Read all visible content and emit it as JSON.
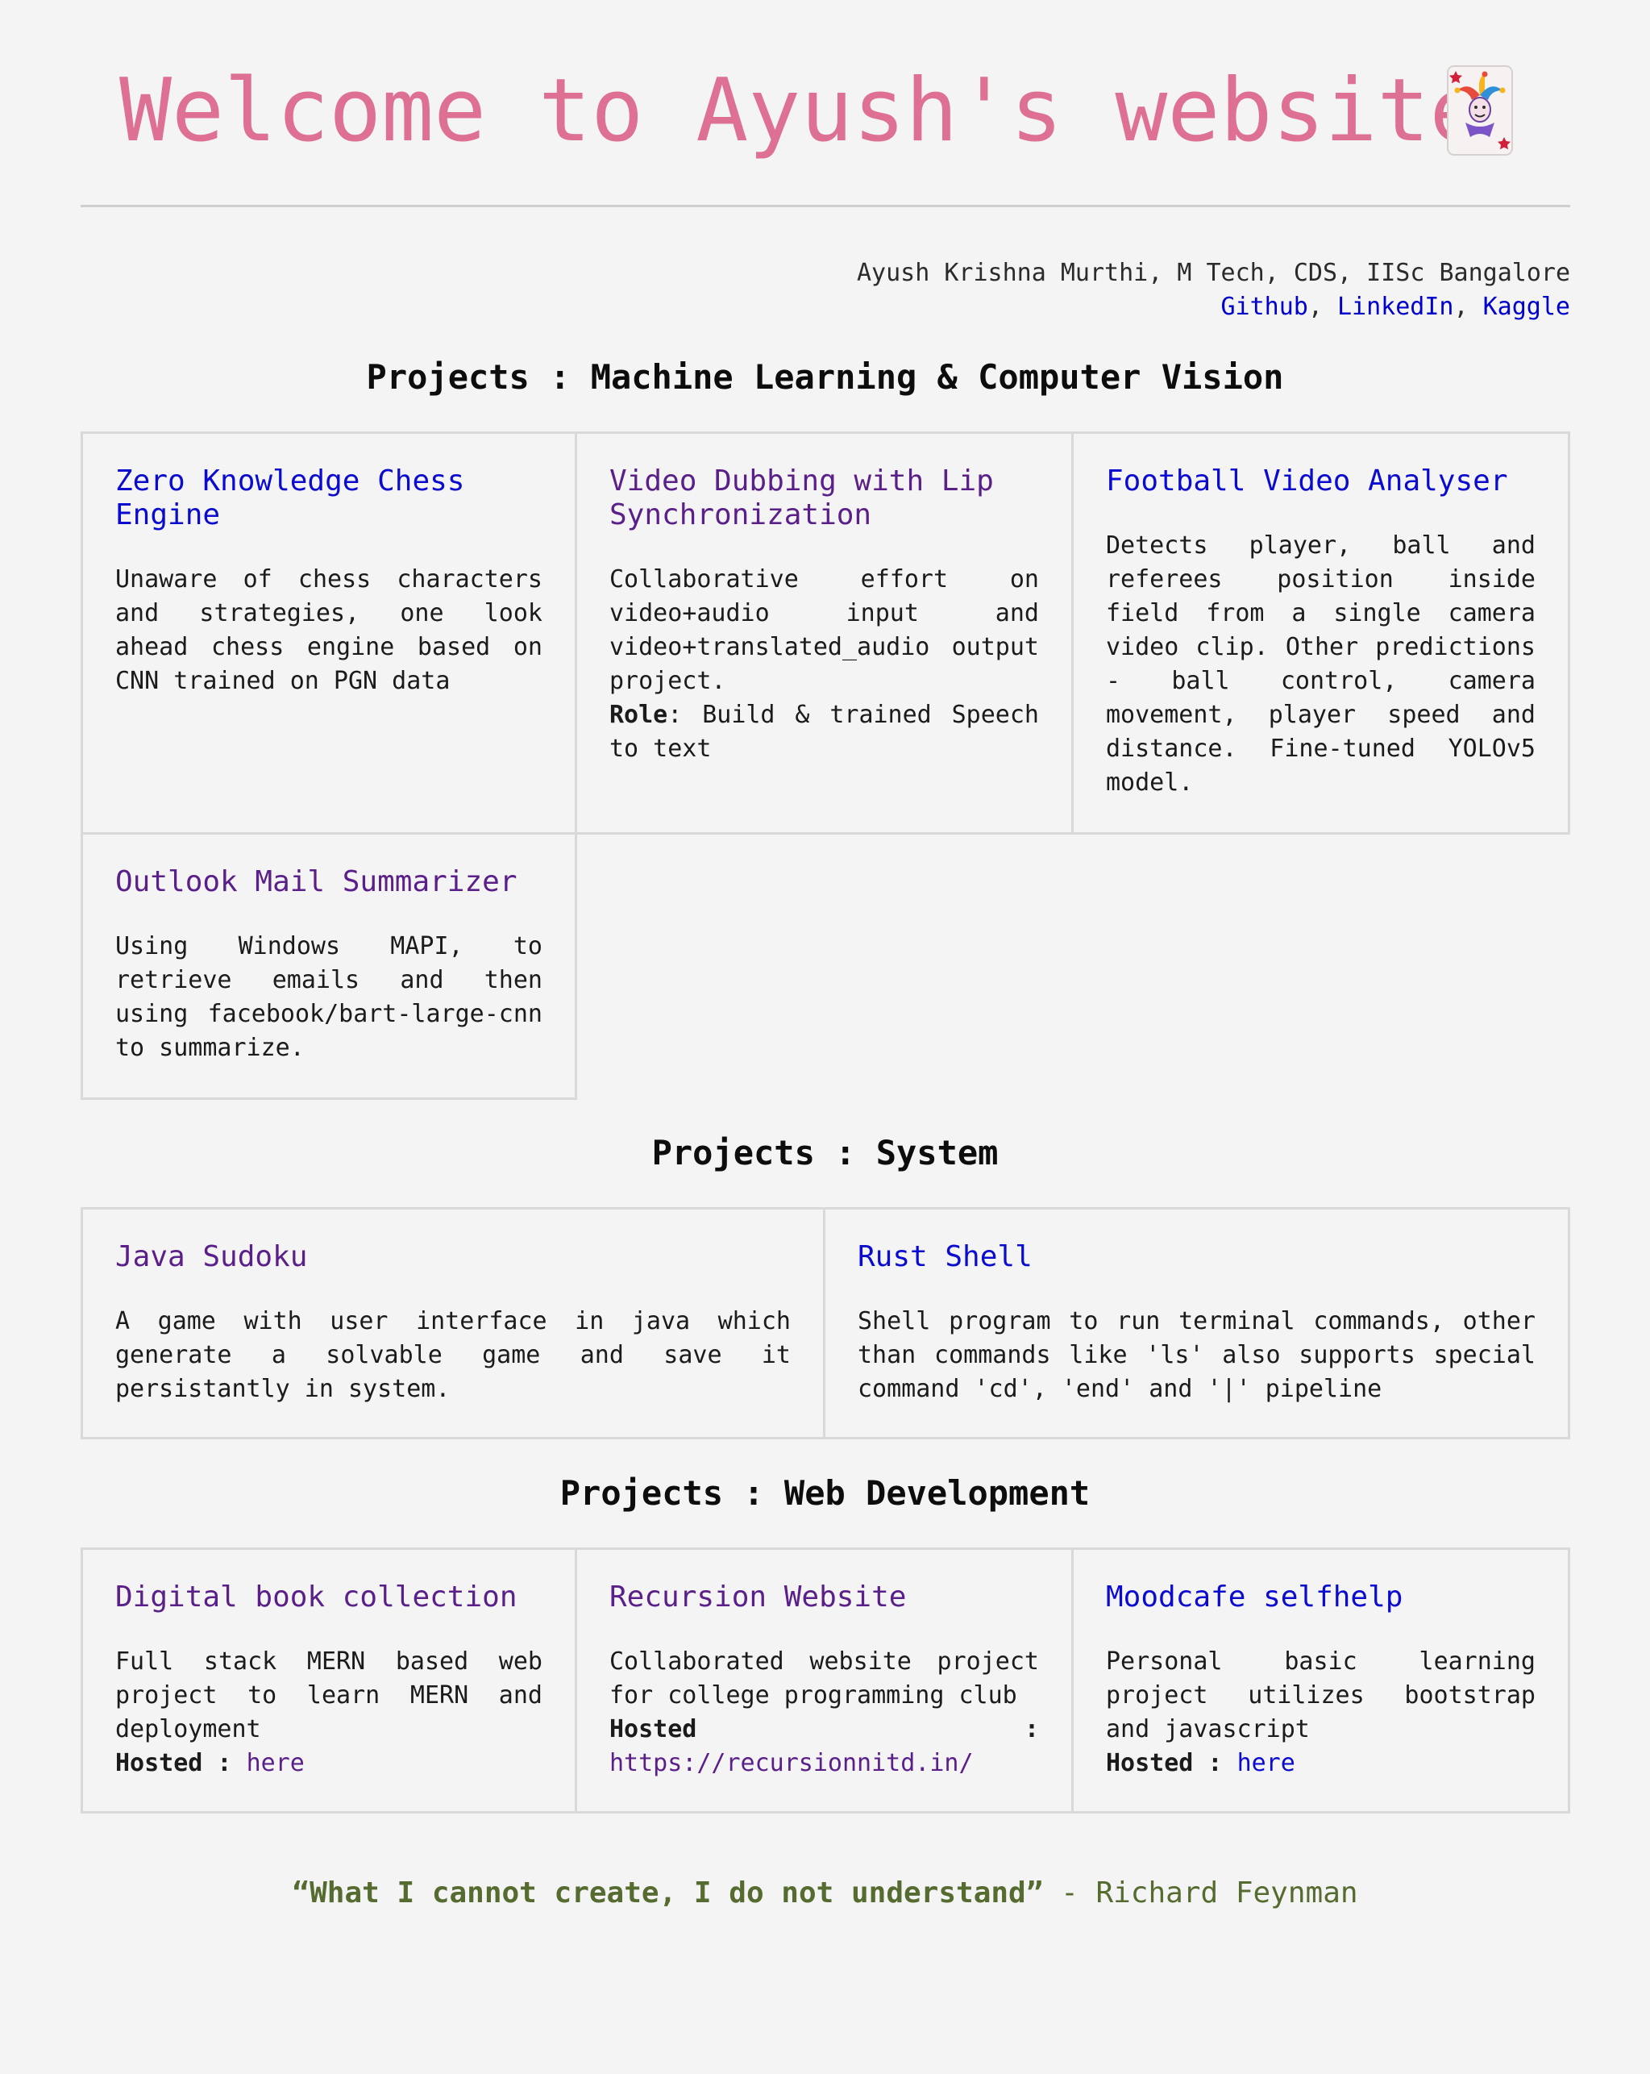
{
  "header": {
    "title": "Welcome to Ayush's website",
    "icon": "joker-card-icon"
  },
  "author": {
    "name_line": "Ayush Krishna Murthi, M Tech, CDS, IISc Bangalore",
    "links": [
      "Github",
      "LinkedIn",
      "Kaggle"
    ],
    "separator": ", "
  },
  "sections": [
    {
      "title": "Projects : Machine Learning & Computer Vision",
      "cards": [
        {
          "title": "Zero Knowledge Chess Engine",
          "desc": "Unaware of chess characters and strategies, one look ahead chess engine based on CNN trained on PGN data"
        },
        {
          "title": "Video Dubbing with Lip Synchronization",
          "desc": "Collaborative effort on video+audio input and video+translated_audio output project.",
          "role_label": "Role",
          "role_text": ": Build & trained Speech to text"
        },
        {
          "title": "Football Video Analyser",
          "desc": "Detects player, ball and referees position inside field from a single camera video clip. Other predictions - ball control, camera movement, player speed and distance. Fine-tuned YOLOv5 model."
        },
        {
          "title": "Outlook Mail Summarizer",
          "desc": "Using Windows MAPI, to retrieve emails and then using facebook/bart-large-cnn to summarize."
        }
      ]
    },
    {
      "title": "Projects : System",
      "cards": [
        {
          "title": "Java Sudoku",
          "desc": "A game with user interface in java which generate a solvable game and save it persistantly in system."
        },
        {
          "title": "Rust Shell",
          "desc": "Shell program to run terminal commands, other than commands like 'ls' also supports special command 'cd', 'end' and '|' pipeline"
        }
      ]
    },
    {
      "title": "Projects : Web Development",
      "cards": [
        {
          "title": "Digital book collection",
          "desc": "Full stack MERN based web project to learn MERN and deployment",
          "hosted_label": "Hosted :",
          "hosted_link": "here"
        },
        {
          "title": "Recursion Website",
          "desc": "Collaborated website project for college programming club",
          "hosted_label": "Hosted",
          "hosted_colon": ":",
          "hosted_link": "https://recursionnitd.in/"
        },
        {
          "title": "Moodcafe selfhelp",
          "desc": "Personal basic learning project utilizes bootstrap and javascript",
          "hosted_label": "Hosted :",
          "hosted_link": "here"
        }
      ]
    }
  ],
  "quote": {
    "text": "“What I cannot create, I do not understand”",
    "attribution": "- Richard Feynman"
  },
  "colors": {
    "background": "#f4f4f4",
    "title_pink": "#dd7093",
    "link_blue": "#0b0bcf",
    "link_visited_purple": "#5a1f88",
    "quote_green": "#556b2f",
    "card_border": "#d9d9d9"
  }
}
